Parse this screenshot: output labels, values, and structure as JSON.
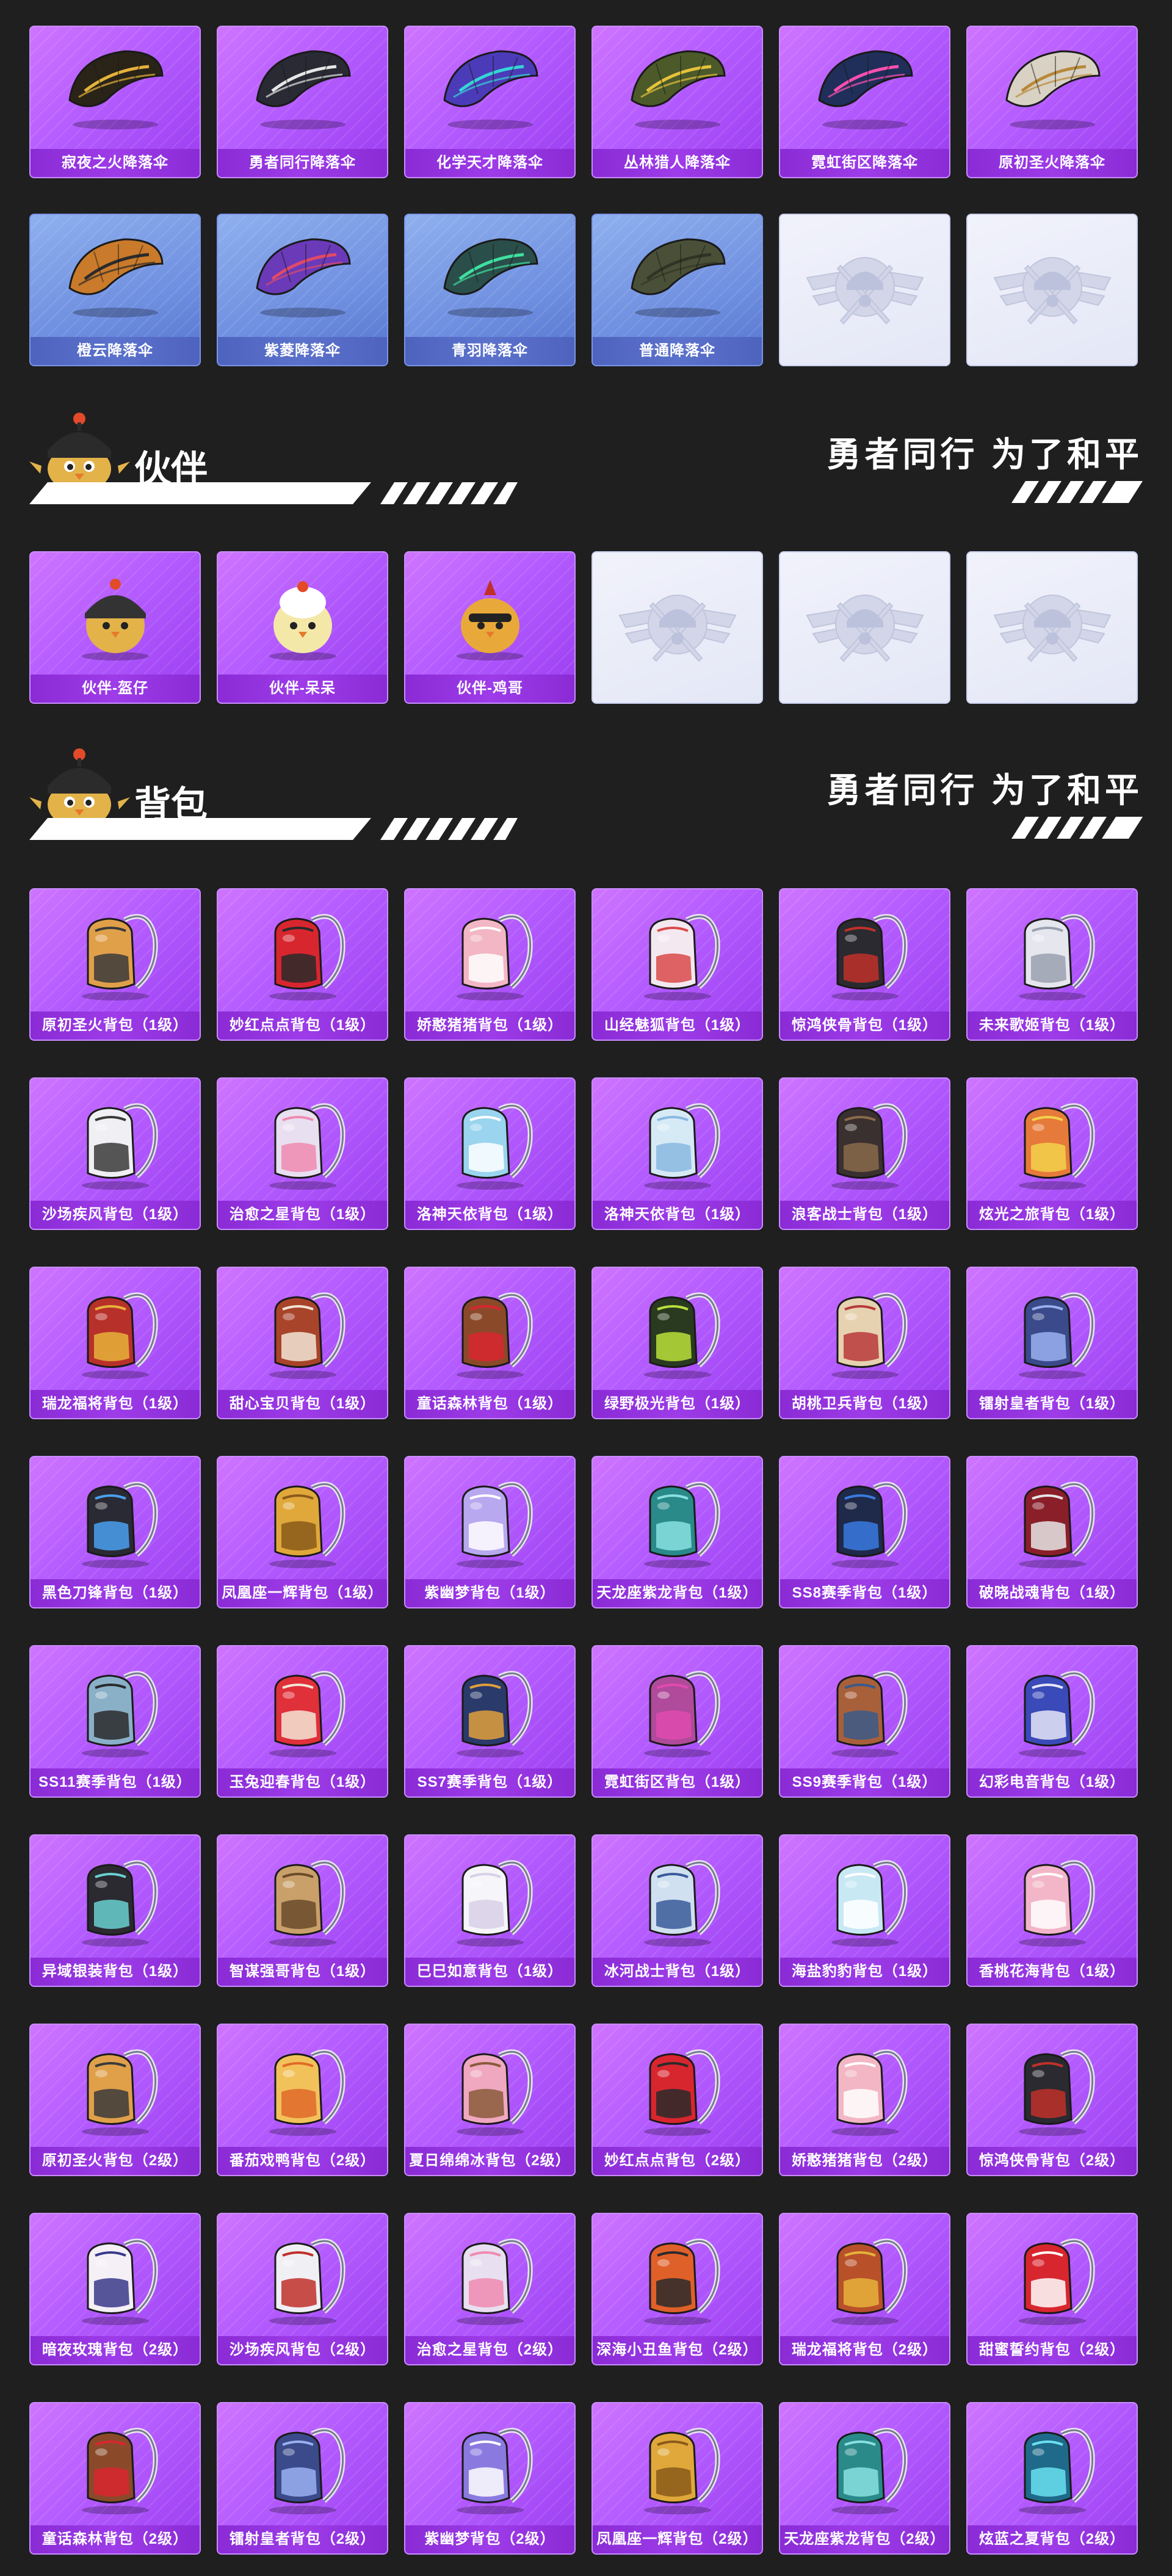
{
  "parachutes": [
    {
      "label": "寂夜之火降落伞",
      "tier": "purple",
      "color": "#2a2418",
      "accent": "#e7b23a"
    },
    {
      "label": "勇者同行降落伞",
      "tier": "purple",
      "color": "#2a2a35",
      "accent": "#e6e6e6"
    },
    {
      "label": "化学天才降落伞",
      "tier": "purple",
      "color": "#4c3bb8",
      "accent": "#35d6d6"
    },
    {
      "label": "丛林猎人降落伞",
      "tier": "purple",
      "color": "#4c5a2a",
      "accent": "#e6c23a"
    },
    {
      "label": "霓虹街区降落伞",
      "tier": "purple",
      "color": "#1f2f5a",
      "accent": "#ff4fb0"
    },
    {
      "label": "原初圣火降落伞",
      "tier": "purple",
      "color": "#d9d2c4",
      "accent": "#b8893a"
    },
    {
      "label": "橙云降落伞",
      "tier": "blue",
      "color": "#c97a2a",
      "accent": "#2b2b2b"
    },
    {
      "label": "紫菱降落伞",
      "tier": "blue",
      "color": "#6a3ab8",
      "accent": "#e04a6a"
    },
    {
      "label": "青羽降落伞",
      "tier": "blue",
      "color": "#2a4f4a",
      "accent": "#3fe0a0"
    },
    {
      "label": "普通降落伞",
      "tier": "blue",
      "color": "#4a5038",
      "accent": "#2f3424"
    },
    {
      "label": "",
      "tier": "empty"
    },
    {
      "label": "",
      "tier": "empty"
    }
  ],
  "companion_section": {
    "title": "伙伴",
    "slogan": "勇者同行 为了和平"
  },
  "companions": [
    {
      "label": "伙伴-盔仔",
      "tier": "purple",
      "color": "#e3b34a",
      "accent": "#333333"
    },
    {
      "label": "伙伴-呆呆",
      "tier": "purple",
      "color": "#f4e8a8",
      "accent": "#ffffff"
    },
    {
      "label": "伙伴-鸡哥",
      "tier": "purple",
      "color": "#e9a93a",
      "accent": "#c0302a"
    },
    {
      "label": "",
      "tier": "empty"
    },
    {
      "label": "",
      "tier": "empty"
    },
    {
      "label": "",
      "tier": "empty"
    }
  ],
  "backpack_section": {
    "title": "背包",
    "slogan": "勇者同行 为了和平"
  },
  "backpacks": [
    {
      "label": "原初圣火背包（1级）",
      "color": "#e0a04a",
      "accent": "#3a3a3a"
    },
    {
      "label": "妙红点点背包（1级）",
      "color": "#d8262f",
      "accent": "#2a2a2a"
    },
    {
      "label": "娇憨猪猪背包（1级）",
      "color": "#f2b6c4",
      "accent": "#ffffff"
    },
    {
      "label": "山经魅狐背包（1级）",
      "color": "#f4e8f0",
      "accent": "#d94a4a"
    },
    {
      "label": "惊鸿侠骨背包（1级）",
      "color": "#2a2a30",
      "accent": "#c0302a"
    },
    {
      "label": "未来歌姬背包（1级）",
      "color": "#e6e6ee",
      "accent": "#9aa0b0"
    },
    {
      "label": "沙场疾风背包（1级）",
      "color": "#f0f0f4",
      "accent": "#3a3a3a"
    },
    {
      "label": "治愈之星背包（1级）",
      "color": "#e8e0f0",
      "accent": "#f08ab0"
    },
    {
      "label": "洛神天依背包（1级）",
      "color": "#9ad4ee",
      "accent": "#ffffff"
    },
    {
      "label": "洛神天依背包（1级）",
      "color": "#d6eaf6",
      "accent": "#8ab8e0"
    },
    {
      "label": "浪客战士背包（1级）",
      "color": "#3a3030",
      "accent": "#8a6a4a"
    },
    {
      "label": "炫光之旅背包（1级）",
      "color": "#e67a3a",
      "accent": "#f2d24a"
    },
    {
      "label": "瑞龙福将背包（1级）",
      "color": "#b8302a",
      "accent": "#e6b23a"
    },
    {
      "label": "甜心宝贝背包（1级）",
      "color": "#a8442a",
      "accent": "#f2e6d6"
    },
    {
      "label": "童话森林背包（1级）",
      "color": "#8a4a2a",
      "accent": "#d8262f"
    },
    {
      "label": "绿野极光背包（1级）",
      "color": "#2a3a20",
      "accent": "#b8e03a"
    },
    {
      "label": "胡桃卫兵背包（1级）",
      "color": "#e6d2b0",
      "accent": "#b83a3a"
    },
    {
      "label": "镭射皇者背包（1级）",
      "color": "#3a4a8a",
      "accent": "#9ab0f0"
    },
    {
      "label": "黑色刀锋背包（1级）",
      "color": "#2a2a34",
      "accent": "#4aa0f0"
    },
    {
      "label": "凤凰座一辉背包（1级）",
      "color": "#e0a83a",
      "accent": "#8a5a1a"
    },
    {
      "label": "紫幽梦背包（1级）",
      "color": "#b8a8f0",
      "accent": "#ffffff"
    },
    {
      "label": "天龙座紫龙背包（1级）",
      "color": "#2a8a8a",
      "accent": "#8ae0e0"
    },
    {
      "label": "SS8赛季背包（1级）",
      "color": "#1f2a4a",
      "accent": "#3a7ae0"
    },
    {
      "label": "破晓战魂背包（1级）",
      "color": "#8a1f2a",
      "accent": "#e6e6e6"
    },
    {
      "label": "SS11赛季背包（1级）",
      "color": "#8ab0c8",
      "accent": "#2a2a2a"
    },
    {
      "label": "玉兔迎春背包（1级）",
      "color": "#e0303a",
      "accent": "#f2e6d6"
    },
    {
      "label": "SS7赛季背包（1级）",
      "color": "#2a3a6a",
      "accent": "#e0a03a"
    },
    {
      "label": "霓虹街区背包（1级）",
      "color": "#b04a9a",
      "accent": "#e04ab0"
    },
    {
      "label": "SS9赛季背包（1级）",
      "color": "#a8603a",
      "accent": "#3a5a8a"
    },
    {
      "label": "幻彩电音背包（1级）",
      "color": "#3a4ab8",
      "accent": "#e6e6f6"
    },
    {
      "label": "异域银装背包（1级）",
      "color": "#2a2a30",
      "accent": "#6ad0d0"
    },
    {
      "label": "智谋强哥背包（1级）",
      "color": "#c9a06a",
      "accent": "#6a4a2a"
    },
    {
      "label": "巳巳如意背包（1级）",
      "color": "#f6f6fa",
      "accent": "#d8d0e8"
    },
    {
      "label": "冰河战士背包（1级）",
      "color": "#d0e0f0",
      "accent": "#3a5a9a"
    },
    {
      "label": "海盐豹豹背包（1级）",
      "color": "#c8e8f4",
      "accent": "#ffffff"
    },
    {
      "label": "香桃花海背包（1级）",
      "color": "#f2b6c8",
      "accent": "#ffffff"
    },
    {
      "label": "原初圣火背包（2级）",
      "color": "#e0a04a",
      "accent": "#3a3a3a"
    },
    {
      "label": "番茄戏鸭背包（2级）",
      "color": "#f2c25a",
      "accent": "#e06a2a"
    },
    {
      "label": "夏日绵绵冰背包（2级）",
      "color": "#f0a8c0",
      "accent": "#8a5a3a"
    },
    {
      "label": "妙红点点背包（2级）",
      "color": "#d8262f",
      "accent": "#2a2a2a"
    },
    {
      "label": "娇憨猪猪背包（2级）",
      "color": "#f2b6c4",
      "accent": "#ffffff"
    },
    {
      "label": "惊鸿侠骨背包（2级）",
      "color": "#2a2a30",
      "accent": "#c0302a"
    },
    {
      "label": "暗夜玫瑰背包（2级）",
      "color": "#f4f0f6",
      "accent": "#3a3a8a"
    },
    {
      "label": "沙场疾风背包（2级）",
      "color": "#f0f0f4",
      "accent": "#c0302a"
    },
    {
      "label": "治愈之星背包（2级）",
      "color": "#e8e0f0",
      "accent": "#f08ab0"
    },
    {
      "label": "深海小丑鱼背包（2级）",
      "color": "#e0602a",
      "accent": "#2a2a2a"
    },
    {
      "label": "瑞龙福将背包（2级）",
      "color": "#b8502a",
      "accent": "#e6b23a"
    },
    {
      "label": "甜蜜誓约背包（2级）",
      "color": "#d8262f",
      "accent": "#ffffff"
    },
    {
      "label": "童话森林背包（2级）",
      "color": "#8a4a2a",
      "accent": "#d8262f"
    },
    {
      "label": "镭射皇者背包（2级）",
      "color": "#3a4a8a",
      "accent": "#9ab0f0"
    },
    {
      "label": "紫幽梦背包（2级）",
      "color": "#8a7ae0",
      "accent": "#ffffff"
    },
    {
      "label": "凤凰座一辉背包（2级）",
      "color": "#e0a83a",
      "accent": "#8a5a1a"
    },
    {
      "label": "天龙座紫龙背包（2级）",
      "color": "#2a8a8a",
      "accent": "#8ae0e0"
    },
    {
      "label": "炫蓝之夏背包（2级）",
      "color": "#1f6a8a",
      "accent": "#6ae0f0"
    }
  ]
}
